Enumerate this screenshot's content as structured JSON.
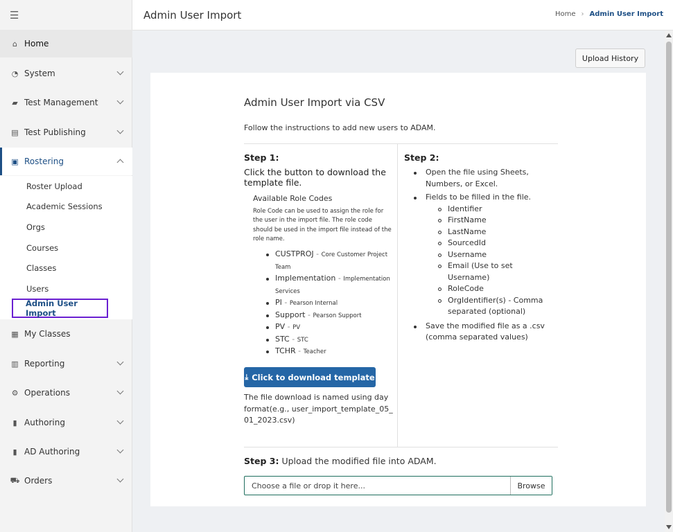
{
  "sidebar": {
    "menu_icon": "hamburger-menu-icon",
    "items": [
      {
        "label": "Home",
        "icon": "home-icon"
      },
      {
        "label": "System",
        "icon": "gauge-icon"
      },
      {
        "label": "Test Management",
        "icon": "folder-open-icon"
      },
      {
        "label": "Test Publishing",
        "icon": "file-export-icon"
      },
      {
        "label": "Rostering",
        "icon": "clipboard-user-icon"
      },
      {
        "label": "My Classes",
        "icon": "classroom-icon"
      },
      {
        "label": "Reporting",
        "icon": "chart-icon"
      },
      {
        "label": "Operations",
        "icon": "cogs-icon"
      },
      {
        "label": "Authoring",
        "icon": "book-icon"
      },
      {
        "label": "AD Authoring",
        "icon": "book-icon"
      },
      {
        "label": "Orders",
        "icon": "cart-icon"
      }
    ],
    "rostering_sub": [
      "Roster Upload",
      "Academic Sessions",
      "Orgs",
      "Courses",
      "Classes",
      "Users",
      "Admin User Import"
    ]
  },
  "header": {
    "title": "Admin User Import",
    "breadcrumb": {
      "home": "Home",
      "current": "Admin User Import"
    }
  },
  "toolbar": {
    "upload_history": "Upload History"
  },
  "panel": {
    "title": "Admin User Import via CSV",
    "intro": "Follow the instructions to add new users to ADAM.",
    "step1": {
      "heading": "Step 1:",
      "text": "Click the button to download the template file.",
      "roles_title": "Available Role Codes",
      "roles_desc": "Role Code can be used to assign the role for the user in the import file. The role code should be used in the import file instead of the role name.",
      "roles": [
        {
          "code": "CUSTPROJ",
          "name": "Core Customer Project Team"
        },
        {
          "code": "Implementation",
          "name": "Implementation Services"
        },
        {
          "code": "PI",
          "name": "Pearson Internal"
        },
        {
          "code": "Support",
          "name": "Pearson Support"
        },
        {
          "code": "PV",
          "name": "PV"
        },
        {
          "code": "STC",
          "name": "STC"
        },
        {
          "code": "TCHR",
          "name": "Teacher"
        }
      ],
      "download_label": "Click to download template",
      "download_note": "The file download is named using day format(e.g., user_import_template_05_01_2023.csv)"
    },
    "step2": {
      "heading": "Step 2:",
      "open_text": "Open the file using Sheets, Numbers, or Excel.",
      "fields_text": "Fields to be filled in the file.",
      "fields": [
        "Identifier",
        "FirstName",
        "LastName",
        "SourcedId",
        "Username",
        "Email (Use to set Username)",
        "RoleCode",
        "OrgIdentifier(s) - Comma separated (optional)"
      ],
      "save_text": "Save the modified file as a .csv (comma separated values)"
    },
    "step3": {
      "heading": "Step 3:",
      "text": "Upload the modified file into ADAM.",
      "placeholder": "Choose a file or drop it here...",
      "browse": "Browse"
    }
  }
}
